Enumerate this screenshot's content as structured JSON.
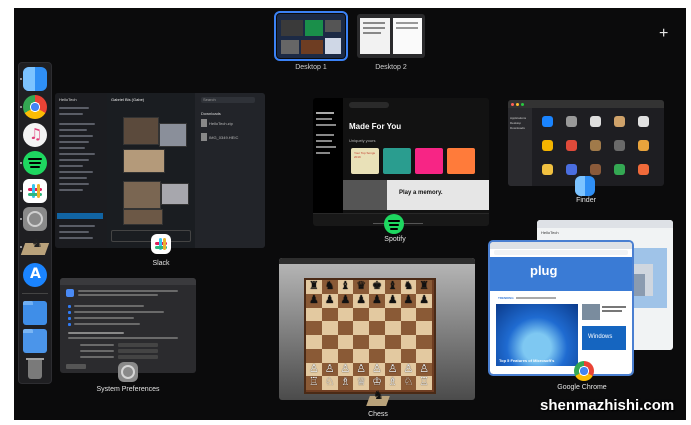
{
  "spaces": {
    "desktops": [
      {
        "label": "Desktop 1",
        "active": true
      },
      {
        "label": "Desktop 2",
        "active": false
      }
    ],
    "add_label": "+"
  },
  "dock": {
    "items": [
      {
        "icon": "finder-icon",
        "color": "#2f8ff5",
        "running": true
      },
      {
        "icon": "chrome-icon",
        "color": "#e8e8e8",
        "running": true
      },
      {
        "icon": "itunes-icon",
        "color": "#f4f4f4",
        "running": false
      },
      {
        "icon": "spotify-icon",
        "color": "#1ed760",
        "running": true
      },
      {
        "icon": "slack-icon",
        "color": "#ffffff",
        "running": true
      },
      {
        "icon": "system-preferences-icon",
        "color": "#8a8a8a",
        "running": true
      },
      {
        "icon": "chess-icon",
        "color": "#b9a27b",
        "running": true
      },
      {
        "icon": "app-store-icon",
        "color": "#1a84ff",
        "running": false
      },
      {
        "icon": "applications-folder-icon",
        "color": "#3f8ee8",
        "running": false
      },
      {
        "icon": "documents-folder-icon",
        "color": "#4b95ea",
        "running": false
      },
      {
        "icon": "trash-icon",
        "color": "#7a7a7a",
        "running": false
      }
    ]
  },
  "windows": {
    "slack": {
      "label": "Slack",
      "badge_icon": "slack-icon",
      "workspace": "HelloTech",
      "channel": "Gabriel Bis (Gabe)",
      "panel_title": "Downloads",
      "file1": "HelloTech.zip",
      "file2": "IMG_0349.HEIC",
      "search": "Search"
    },
    "spotify": {
      "label": "Spotify",
      "badge_icon": "spotify-icon",
      "heading": "Made For You",
      "subheading": "Uniquely yours",
      "promo": "Play a memory.",
      "promo_sub": "Your Top Songs 2019"
    },
    "finder": {
      "label": "Finder",
      "badge_icon": "finder-icon",
      "sidebar": [
        "Applications",
        "Desktop",
        "Downloads"
      ]
    },
    "system_preferences": {
      "label": "System Preferences",
      "badge_icon": "system-preferences-icon"
    },
    "chess": {
      "label": "Chess",
      "badge_icon": "chess-icon"
    },
    "chrome": {
      "label": "Google Chrome",
      "badge_icon": "chrome-icon",
      "site": "plug",
      "trending": "TRENDING",
      "article": "Top 5 Features of Microsoft's",
      "brand": "Windows",
      "back_site": "HelloTech"
    }
  },
  "watermark": "shenmazhishi.com"
}
